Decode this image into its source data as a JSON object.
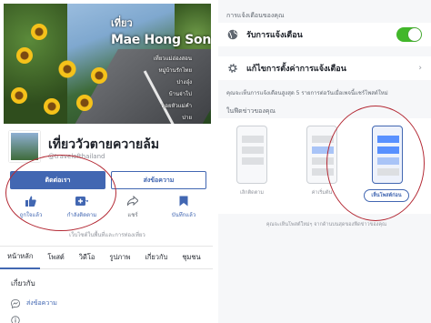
{
  "left": {
    "cover": {
      "title_small": "เที่ยว",
      "title_big": "Mae Hong Son",
      "lines": [
        "เที่ยวแม่ฮ่องสอน",
        "หมู่บ้านรักไทย",
        "ปางอุ๋ง",
        "บ้านจ่าโบ่",
        "ดอยหัวแม่คำ",
        "ปาย"
      ]
    },
    "page_name": "เที่ยววัวตายควายล้ม",
    "page_handle": "@travelofthailand",
    "like_button": "ติดต่อเรา",
    "message_button": "ส่งข้อความ",
    "actions": [
      {
        "icon": "thumbs-up-icon",
        "label": "ถูกใจแล้ว"
      },
      {
        "icon": "following-icon",
        "label": "กำลังติดตาม"
      },
      {
        "icon": "share-icon",
        "label": "แชร์"
      },
      {
        "icon": "bookmark-icon",
        "label": "บันทึกแล้ว"
      }
    ],
    "recommend_text": "เว็บไซต์ในพื้นที่และการท่องเที่ยว",
    "tabs": [
      "หน้าหลัก",
      "โพสต์",
      "วิดีโอ",
      "รูปภาพ",
      "เกี่ยวกับ",
      "ชุมชน"
    ],
    "about_heading": "เกี่ยวกับ",
    "about_message": "ส่งข้อความ"
  },
  "right": {
    "notifications_header": "การแจ้งเตือนของคุณ",
    "receive_notifications": "รับการแจ้งเตือน",
    "edit_notification_settings": "แก้ไขการตั้งค่าการแจ้งเตือน",
    "description": "คุณจะเห็นการแจ้งเตือนสูงสุด 5 รายการต่อวันเมื่อเพจนี้แชร์โพสต์ใหม่",
    "feed_header": "ในฟีดข่าวของคุณ",
    "feed_options": [
      {
        "label": "เลิกติดตาม",
        "selected": false
      },
      {
        "label": "ค่าเริ่มต้น",
        "selected": false
      },
      {
        "label": "เห็นโพสต์ก่อน",
        "selected": true
      }
    ],
    "footer": "คุณจะเห็นโพสต์ใหม่ๆ จากด้านบนสุดของฟีดข่าวของคุณ",
    "accent": "#4267b2",
    "toggle_color": "#42b72a",
    "highlight_color": "#b42a35"
  }
}
